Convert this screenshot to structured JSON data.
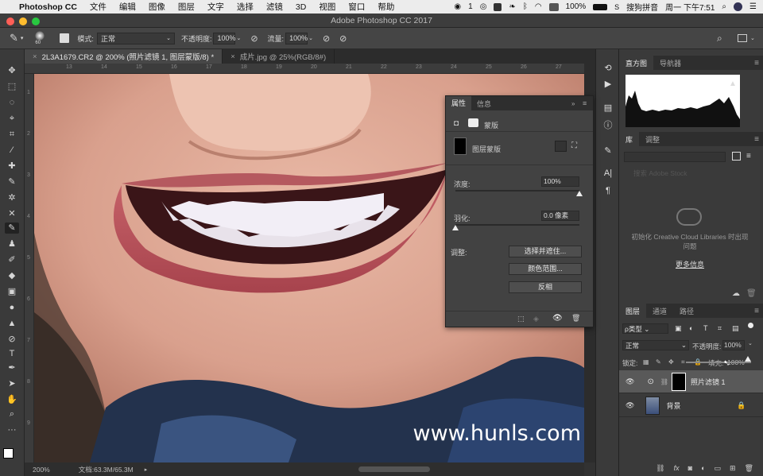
{
  "menubar": {
    "app_name": "Photoshop CC",
    "items": [
      "文件",
      "编辑",
      "图像",
      "图层",
      "文字",
      "选择",
      "滤镜",
      "3D",
      "视图",
      "窗口",
      "帮助"
    ],
    "status": {
      "wechat_count": "1",
      "battery": "100%",
      "input_method": "搜狗拼音",
      "clock": "周一 下午7:51"
    }
  },
  "window": {
    "title": "Adobe Photoshop CC 2017"
  },
  "options": {
    "brush_size": "60",
    "mode_label": "模式:",
    "mode_value": "正常",
    "opacity_label": "不透明度:",
    "opacity_value": "100%",
    "flow_label": "流量:",
    "flow_value": "100%"
  },
  "tabs": [
    {
      "label": "2L3A1679.CR2 @ 200% (照片滤镜 1, 图层蒙版/8) *",
      "close": "×"
    },
    {
      "label": "成片.jpg @ 25%(RGB/8#)",
      "close": "×"
    }
  ],
  "ruler": {
    "top_labels": [
      "13",
      "14",
      "15",
      "16",
      "17",
      "18",
      "19",
      "20",
      "21",
      "22",
      "23",
      "24",
      "25",
      "26",
      "27"
    ],
    "left_labels": [
      "1",
      "2",
      "3",
      "4",
      "5",
      "6",
      "7",
      "8",
      "9"
    ]
  },
  "status": {
    "zoom": "200%",
    "doc_info": "文档:63.3M/65.3M"
  },
  "watermark": "www.hunls.com",
  "properties_panel": {
    "tabs": [
      "属性",
      "信息"
    ],
    "mask_type": "蒙版",
    "layer_mask_label": "图层蒙版",
    "density_label": "浓度:",
    "density_value": "100%",
    "density_level_pct": 100,
    "feather_label": "羽化:",
    "feather_value": "0.0 像素",
    "feather_level_pct": 0,
    "adjust_label": "调整:",
    "buttons": [
      "选择并遮住...",
      "颜色范围...",
      "反相"
    ]
  },
  "histogram_panel": {
    "tabs": [
      "直方图",
      "导航器"
    ]
  },
  "library_panel": {
    "tabs": [
      "库",
      "调整"
    ],
    "search_placeholder": "搜索 Adobe Stock",
    "message": "初始化 Creative Cloud Libraries 时出现问题",
    "link": "更多信息"
  },
  "layers_panel": {
    "tabs": [
      "图层",
      "通道",
      "路径"
    ],
    "filter_label": "ρ类型",
    "blend_mode": "正常",
    "opacity_label": "不透明度:",
    "opacity_value": "100%",
    "lock_label": "锁定:",
    "fill_label": "填充:",
    "fill_value": "100%",
    "layers": [
      {
        "name": "照片滤镜 1",
        "visible": true,
        "selected": true
      },
      {
        "name": "背景",
        "visible": true,
        "selected": false,
        "locked": true
      }
    ],
    "footer_icons": [
      "link-icon",
      "fx-icon",
      "mask-icon",
      "adjustment-icon",
      "group-icon",
      "new-layer-icon",
      "trash-icon"
    ]
  },
  "colors": {
    "menubar": "#ececec",
    "panel": "#3a3a3a",
    "accent_close": "#ff5f57",
    "accent_min": "#febc2e",
    "accent_max": "#28c840"
  }
}
